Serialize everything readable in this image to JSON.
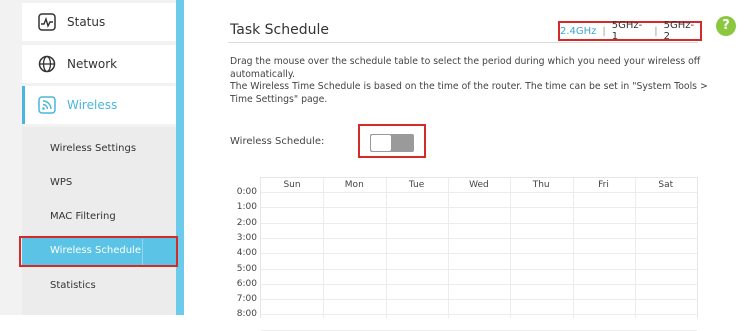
{
  "sidebar": {
    "items": [
      {
        "label": "Status",
        "icon": "status-icon"
      },
      {
        "label": "Network",
        "icon": "globe-icon"
      },
      {
        "label": "Wireless",
        "icon": "wifi-icon"
      }
    ],
    "sub_items": [
      {
        "label": "Wireless Settings"
      },
      {
        "label": "WPS"
      },
      {
        "label": "MAC Filtering"
      },
      {
        "label": "Wireless Schedule"
      },
      {
        "label": "Statistics"
      }
    ]
  },
  "main": {
    "title": "Task Schedule",
    "bands": [
      "2.4GHz",
      "5GHz-1",
      "5GHz-2"
    ],
    "band_separator": "|",
    "description_1": "Drag the mouse over the schedule table to select the period during which you need your wireless off automatically.",
    "description_2": "The Wireless Time Schedule is based on the time of the router. The time can be set in \"System Tools > Time Settings\" page.",
    "schedule_label": "Wireless Schedule:",
    "schedule_enabled": false,
    "help_label": "?",
    "days": [
      "Sun",
      "Mon",
      "Tue",
      "Wed",
      "Thu",
      "Fri",
      "Sat"
    ],
    "hours": [
      "0:00",
      "1:00",
      "2:00",
      "3:00",
      "4:00",
      "5:00",
      "6:00",
      "7:00",
      "8:00"
    ]
  },
  "colors": {
    "accent": "#4ab6dd",
    "highlight_border": "#d42a2a",
    "help": "#8bc83f"
  }
}
